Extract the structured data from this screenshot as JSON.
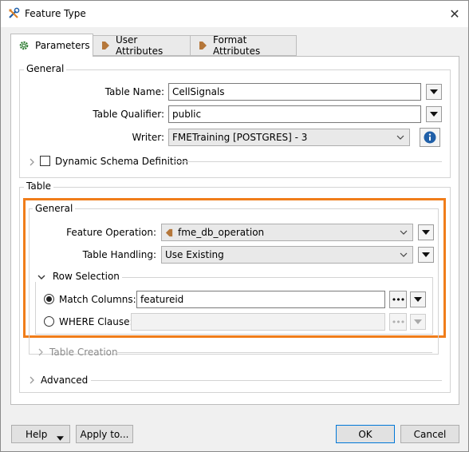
{
  "window": {
    "title": "Feature Type",
    "close_glyph": "✕"
  },
  "tabs": [
    {
      "label": "Parameters",
      "icon": "gear-icon",
      "active": true
    },
    {
      "label": "User Attributes",
      "icon": "arrow-right-icon"
    },
    {
      "label": "Format Attributes",
      "icon": "arrow-right-icon"
    }
  ],
  "general": {
    "legend": "General",
    "table_name_label": "Table Name:",
    "table_name_value": "CellSignals",
    "table_qualifier_label": "Table Qualifier:",
    "table_qualifier_value": "public",
    "writer_label": "Writer:",
    "writer_value": "FMETraining [POSTGRES] - 3",
    "dynamic_schema_label": "Dynamic Schema Definition"
  },
  "table": {
    "legend": "Table",
    "general_legend": "General",
    "feature_operation_label": "Feature Operation:",
    "feature_operation_value": "fme_db_operation",
    "table_handling_label": "Table Handling:",
    "table_handling_value": "Use Existing",
    "row_selection": {
      "legend": "Row Selection",
      "match_columns_label": "Match Columns:",
      "match_columns_value": "featureid",
      "where_clause_label": "WHERE Clause:",
      "where_clause_value": "",
      "selected": "match_columns"
    },
    "table_creation_label": "Table Creation"
  },
  "advanced_label": "Advanced",
  "footer": {
    "help_label": "Help",
    "apply_label": "Apply to...",
    "ok_label": "OK",
    "cancel_label": "Cancel"
  },
  "colors": {
    "highlight": "#f07d1a",
    "info": "#1f5fa8",
    "accent": "#0078d7"
  }
}
